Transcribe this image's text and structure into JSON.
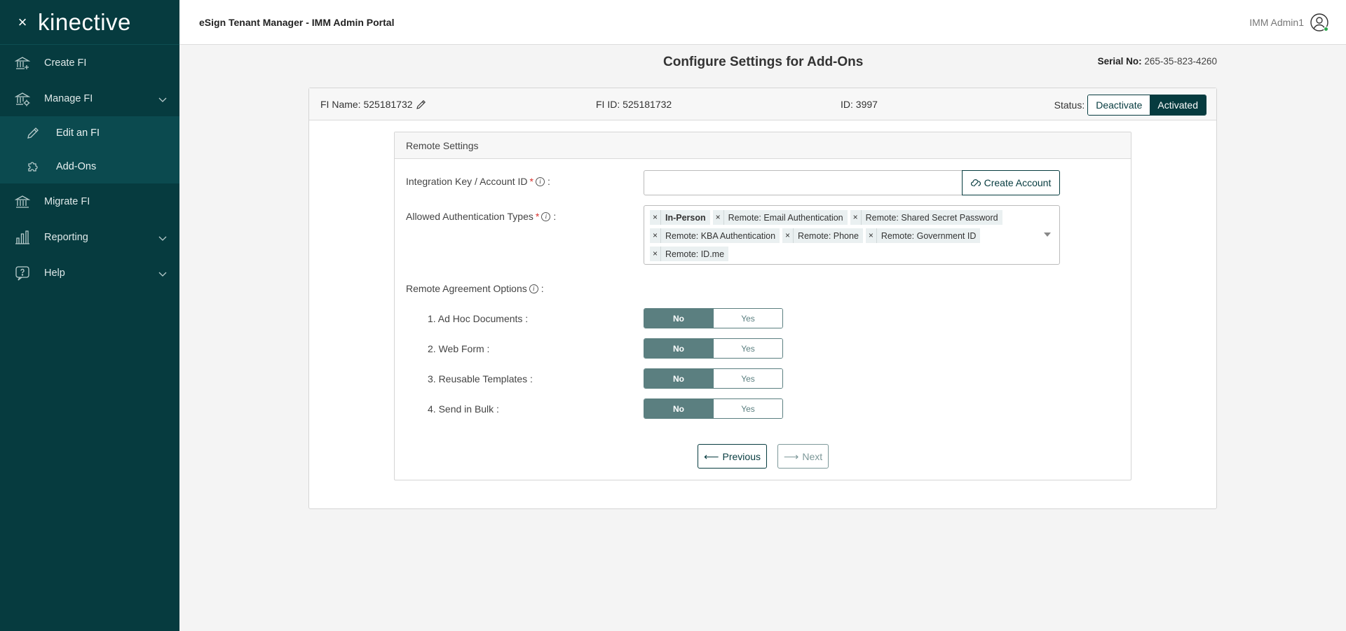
{
  "sidebar": {
    "close_icon": "×",
    "logo": "kinective",
    "items": [
      {
        "label": "Create FI",
        "icon": "bank-plus-icon"
      },
      {
        "label": "Manage FI",
        "icon": "bank-gear-icon"
      },
      {
        "label": "Migrate FI",
        "icon": "bank-icon"
      },
      {
        "label": "Reporting",
        "icon": "bar-chart-icon"
      },
      {
        "label": "Help",
        "icon": "help-bubble-icon"
      }
    ],
    "subitems": [
      {
        "label": "Edit an FI",
        "icon": "pencil-icon"
      },
      {
        "label": "Add-Ons",
        "icon": "puzzle-icon"
      }
    ]
  },
  "topbar": {
    "title": "eSign Tenant Manager - IMM Admin Portal",
    "user": "IMM Admin1"
  },
  "page": {
    "title": "Configure Settings for Add-Ons",
    "serial_label": "Serial No:",
    "serial_value": "265-35-823-4260"
  },
  "fi": {
    "name": "FI Name: 525181732",
    "fi_id": "FI ID: 525181732",
    "id": "ID: 3997",
    "status_label": "Status:",
    "deactivate": "Deactivate",
    "activated": "Activated"
  },
  "remote": {
    "heading": "Remote Settings",
    "key_label": "Integration Key / Account ID",
    "key_value": "",
    "create_account": "Create Account",
    "auth_label": "Allowed Authentication Types",
    "auth_types": [
      "In-Person",
      "Remote: Email Authentication",
      "Remote: Shared Secret Password",
      "Remote: KBA Authentication",
      "Remote: Phone",
      "Remote: Government ID",
      "Remote: ID.me"
    ],
    "agreement_label": "Remote Agreement Options",
    "options": [
      {
        "label": "1. Ad Hoc Documents :",
        "value": "No"
      },
      {
        "label": "2. Web Form :",
        "value": "No"
      },
      {
        "label": "3. Reusable Templates :",
        "value": "No"
      },
      {
        "label": "4. Send in Bulk :",
        "value": "No"
      }
    ],
    "no": "No",
    "yes": "Yes",
    "previous": "Previous",
    "next": "Next"
  },
  "colors": {
    "brand": "#063b3f",
    "toggle_selected": "#5b7f80",
    "required": "#d9302c",
    "online": "#2ba84a"
  }
}
